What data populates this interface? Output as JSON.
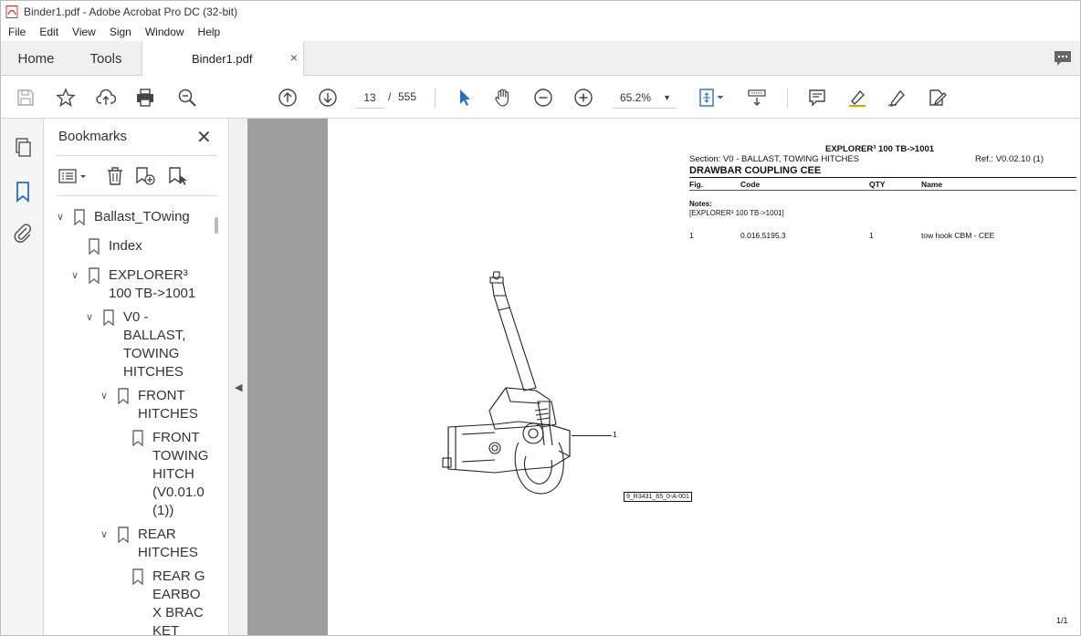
{
  "window": {
    "title": "Binder1.pdf - Adobe Acrobat Pro DC (32-bit)"
  },
  "menu": [
    "File",
    "Edit",
    "View",
    "Sign",
    "Window",
    "Help"
  ],
  "tabs": {
    "home": "Home",
    "tools": "Tools",
    "doc": "Binder1.pdf",
    "close": "×"
  },
  "toolbar": {
    "page_current": "13",
    "page_sep": "/",
    "page_total": "555",
    "zoom": "65.2%"
  },
  "bookmarks": {
    "title": "Bookmarks",
    "close": "✕",
    "items": [
      {
        "label": "Ballast_TOwing",
        "expanded": true
      },
      {
        "label": "Index"
      },
      {
        "label": "EXPLORER³ 100 TB->1001",
        "expanded": true
      },
      {
        "label": "V0 - BALLAST, TOWING HITCHES",
        "expanded": true
      },
      {
        "label": "FRONT HITCHES",
        "expanded": true
      },
      {
        "label": "FRONT TOWING HITCH (V0.01.0 (1))"
      },
      {
        "label": "REAR HITCHES",
        "expanded": true
      },
      {
        "label": "REAR GEARBOX BRACKET"
      }
    ]
  },
  "document": {
    "title": "EXPLORER³ 100 TB->1001",
    "section": "Section: V0 - BALLAST, TOWING HITCHES",
    "ref": "Ref.: V0.02.10 (1)",
    "heading": "DRAWBAR COUPLING CEE",
    "columns": {
      "fig": "Fig.",
      "code": "Code",
      "qty": "QTY",
      "name": "Name"
    },
    "notes_label": "Notes:",
    "notes_text": "[EXPLORER³ 100 TB->1001]",
    "row": {
      "fig": "1",
      "code": "0.016.5195.3",
      "qty": "1",
      "name": "tow hook CBM - CEE"
    },
    "callout": "1",
    "figure_id": "9_R3431_65_0-A-001",
    "page_label": "1/1"
  },
  "colors": {
    "accent_blue": "#2a6ebb",
    "acrobat_red": "#d32f2f",
    "gray_margin": "#9e9e9e"
  }
}
